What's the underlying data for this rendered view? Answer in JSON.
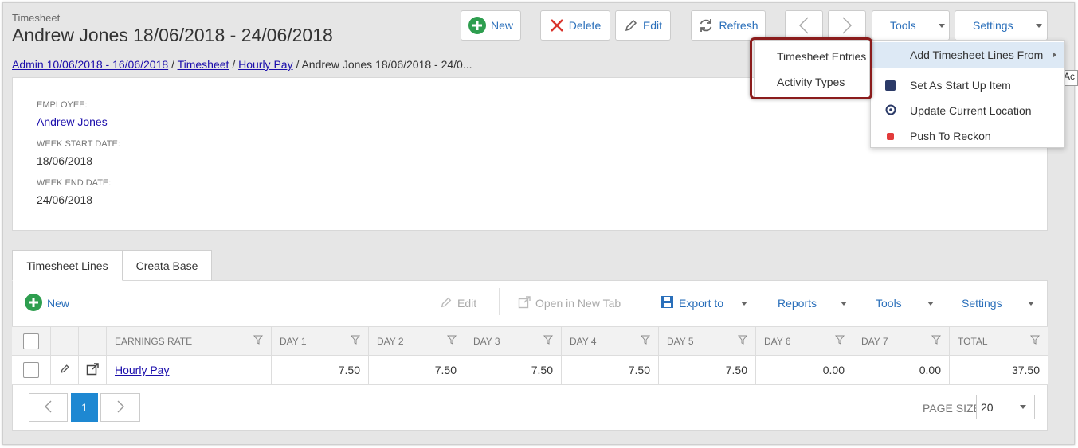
{
  "header": {
    "subtitle": "Timesheet",
    "title": "Andrew Jones 18/06/2018 - 24/06/2018"
  },
  "toolbar": {
    "new_label": "New",
    "delete_label": "Delete",
    "edit_label": "Edit",
    "refresh_label": "Refresh",
    "tools_label": "Tools",
    "settings_label": "Settings"
  },
  "breadcrumb": {
    "items": [
      "Admin 10/06/2018 - 16/06/2018",
      "Timesheet",
      "Hourly Pay"
    ],
    "current": "Andrew Jones 18/06/2018 - 24/0..."
  },
  "details": {
    "employee_label": "EMPLOYEE:",
    "employee_value": "Andrew Jones",
    "start_label": "WEEK START DATE:",
    "start_value": "18/06/2018",
    "end_label": "WEEK END DATE:",
    "end_value": "24/06/2018"
  },
  "tabs": [
    {
      "label": "Timesheet Lines"
    },
    {
      "label": "Creata Base"
    }
  ],
  "grid_toolbar": {
    "new_label": "New",
    "edit_label": "Edit",
    "open_tab_label": "Open in New Tab",
    "export_label": "Export to",
    "reports_label": "Reports",
    "tools_label": "Tools",
    "settings_label": "Settings"
  },
  "grid": {
    "columns": [
      "EARNINGS RATE",
      "DAY 1",
      "DAY 2",
      "DAY 3",
      "DAY 4",
      "DAY 5",
      "DAY 6",
      "DAY 7",
      "TOTAL"
    ],
    "rows": [
      {
        "rate": "Hourly Pay",
        "d1": "7.50",
        "d2": "7.50",
        "d3": "7.50",
        "d4": "7.50",
        "d5": "7.50",
        "d6": "0.00",
        "d7": "0.00",
        "total": "37.50"
      }
    ]
  },
  "pager": {
    "current_page": "1",
    "page_size_label": "PAGE SIZE",
    "page_size_value": "20"
  },
  "tools_menu": {
    "items": [
      {
        "label": "Add Timesheet Lines From",
        "icon": "chevron-right-icon"
      },
      {
        "label": "Set As Start Up Item",
        "icon": "square-icon"
      },
      {
        "label": "Update Current Location",
        "icon": "location-icon"
      },
      {
        "label": "Push To Reckon",
        "icon": "reckon-icon"
      }
    ]
  },
  "submenu": {
    "items": [
      {
        "label": "Timesheet Entries"
      },
      {
        "label": "Activity Types"
      }
    ]
  },
  "tooltip": {
    "text": "Ac"
  },
  "colors": {
    "accent": "#2a6fba",
    "new_green": "#2e9e4f",
    "delete_red": "#d9332b",
    "highlight_border": "#8b1c1c",
    "page_current": "#1e88d2"
  }
}
